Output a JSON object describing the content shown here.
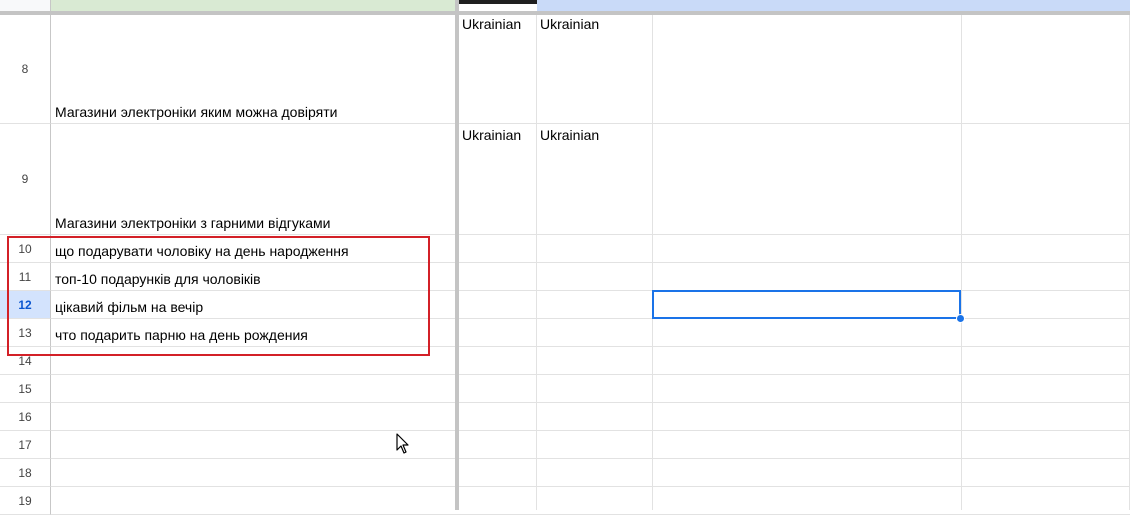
{
  "rows": [
    {
      "num": "8",
      "col_a": "Магазини электроніки яким можна довіряти",
      "col_b": "Ukrainian",
      "col_c": "Ukrainian"
    },
    {
      "num": "9",
      "col_a": "Магазини электроніки з гарними відгуками",
      "col_b": "Ukrainian",
      "col_c": "Ukrainian"
    },
    {
      "num": "10",
      "col_a": "що подарувати чоловіку на день народження",
      "col_b": "",
      "col_c": ""
    },
    {
      "num": "11",
      "col_a": "топ-10 подарунків для чоловіків",
      "col_b": "",
      "col_c": ""
    },
    {
      "num": "12",
      "col_a": "цікавий фільм на вечір",
      "col_b": "",
      "col_c": ""
    },
    {
      "num": "13",
      "col_a": "что подарить парню на день рождения",
      "col_b": "",
      "col_c": ""
    },
    {
      "num": "14",
      "col_a": "",
      "col_b": "",
      "col_c": ""
    },
    {
      "num": "15",
      "col_a": "",
      "col_b": "",
      "col_c": ""
    },
    {
      "num": "16",
      "col_a": "",
      "col_b": "",
      "col_c": ""
    },
    {
      "num": "17",
      "col_a": "",
      "col_b": "",
      "col_c": ""
    },
    {
      "num": "18",
      "col_a": "",
      "col_b": "",
      "col_c": ""
    },
    {
      "num": "19",
      "col_a": "",
      "col_b": "",
      "col_c": ""
    }
  ],
  "selected_row": "12",
  "colors": {
    "selection": "#1a73e8",
    "highlight_box": "#d32027",
    "header_green": "#d9ead3",
    "header_blue": "#c9daf8"
  }
}
